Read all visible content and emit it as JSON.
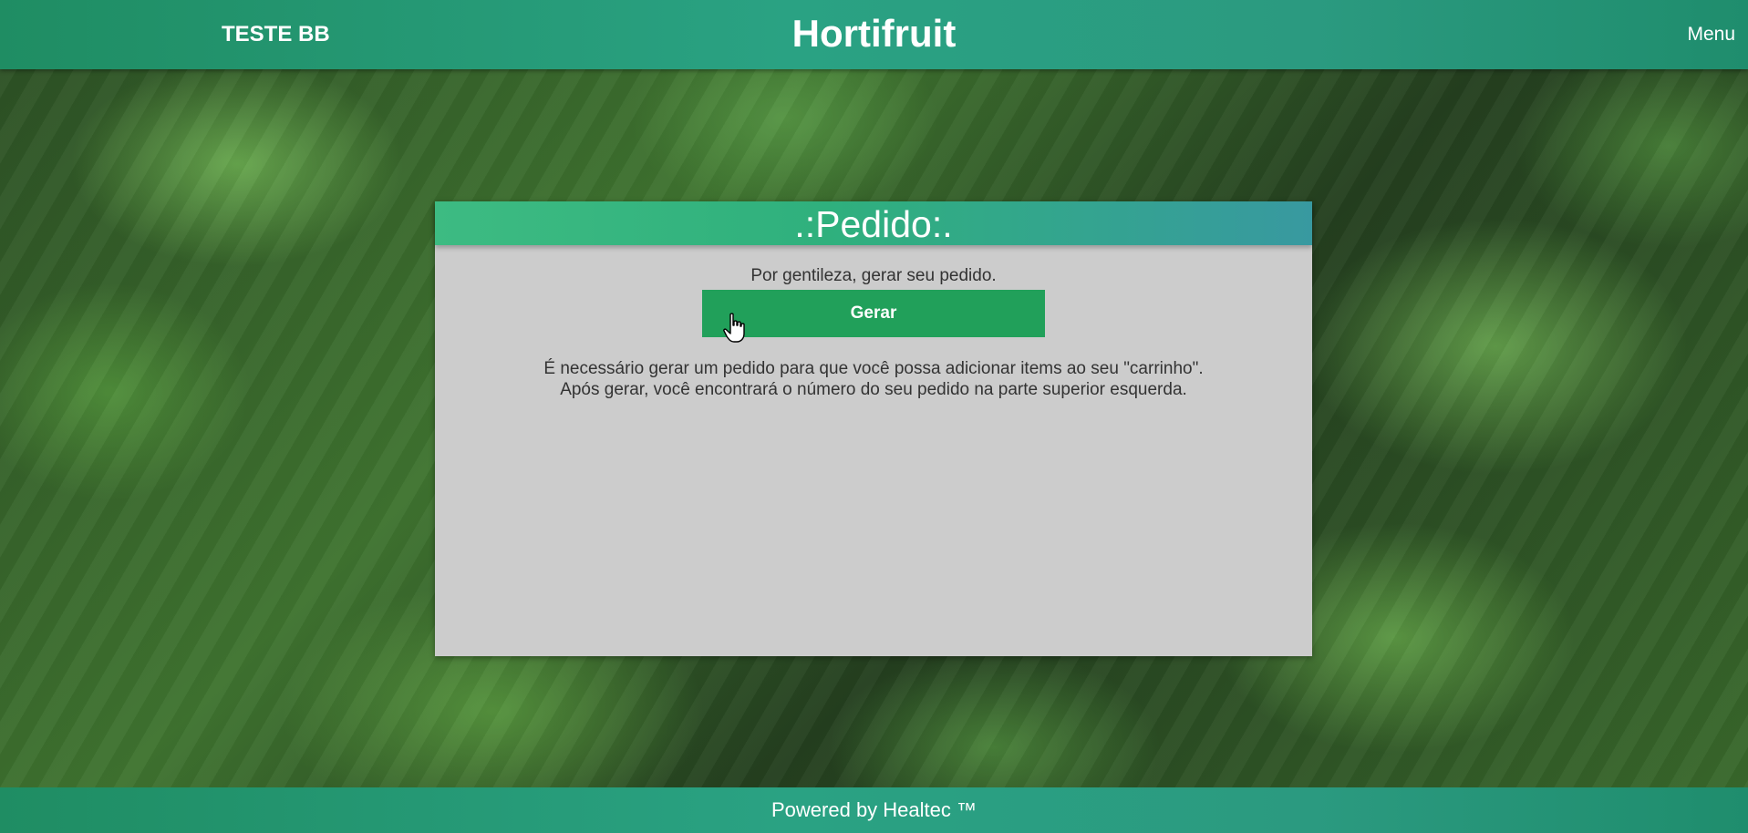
{
  "header": {
    "left_text": "TESTE BB",
    "title": "Hortifruit",
    "menu_label": "Menu"
  },
  "panel": {
    "title": ".:Pedido:.",
    "instruction": "Por gentileza, gerar seu pedido.",
    "button_label": "Gerar",
    "info_line1": "É necessário gerar um pedido para que você possa adicionar items ao seu \"carrinho\".",
    "info_line2": "Após gerar, você encontrará o número do seu pedido na parte superior esquerda."
  },
  "footer": {
    "text": "Powered by Healtec ™"
  },
  "colors": {
    "header_bar": "#2aa283",
    "panel_background": "#cccccc",
    "button": "#21a05a",
    "panel_header": "#2fb07d"
  },
  "icons": {
    "cursor": "hand-pointer-icon"
  }
}
